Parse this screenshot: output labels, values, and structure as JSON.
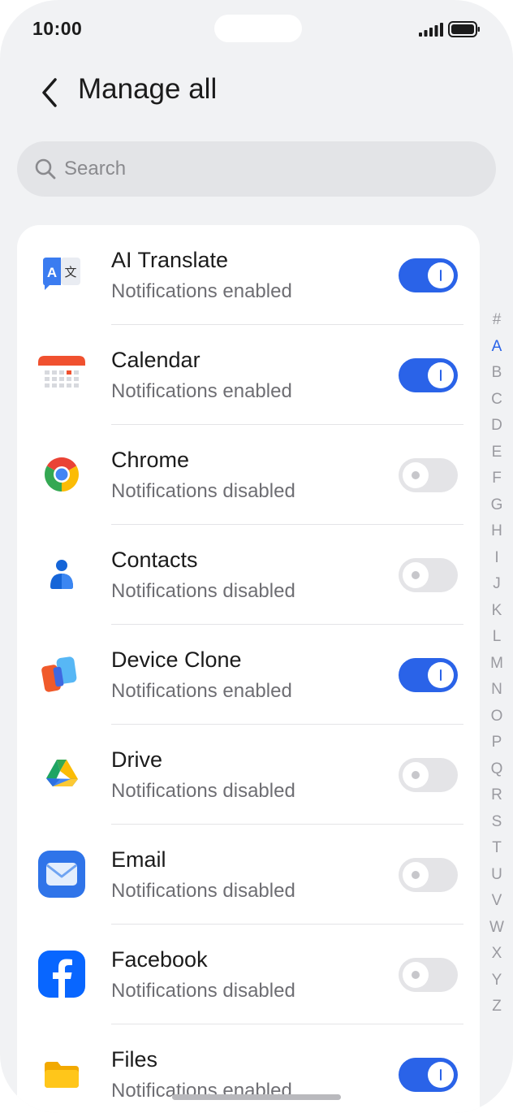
{
  "status_bar": {
    "time": "10:00"
  },
  "header": {
    "title": "Manage all"
  },
  "search": {
    "placeholder": "Search"
  },
  "apps": [
    {
      "name": "AI Translate",
      "status": "Notifications enabled",
      "enabled": true,
      "icon": "ai-translate-icon"
    },
    {
      "name": "Calendar",
      "status": "Notifications enabled",
      "enabled": true,
      "icon": "calendar-icon"
    },
    {
      "name": "Chrome",
      "status": "Notifications disabled",
      "enabled": false,
      "icon": "chrome-icon"
    },
    {
      "name": "Contacts",
      "status": "Notifications disabled",
      "enabled": false,
      "icon": "contacts-icon"
    },
    {
      "name": "Device Clone",
      "status": "Notifications enabled",
      "enabled": true,
      "icon": "device-clone-icon"
    },
    {
      "name": "Drive",
      "status": "Notifications disabled",
      "enabled": false,
      "icon": "drive-icon"
    },
    {
      "name": "Email",
      "status": "Notifications disabled",
      "enabled": false,
      "icon": "email-icon"
    },
    {
      "name": "Facebook",
      "status": "Notifications disabled",
      "enabled": false,
      "icon": "facebook-icon"
    },
    {
      "name": "Files",
      "status": "Notifications enabled",
      "enabled": true,
      "icon": "files-icon"
    }
  ],
  "index_letters": [
    "#",
    "A",
    "B",
    "C",
    "D",
    "E",
    "F",
    "G",
    "H",
    "I",
    "J",
    "K",
    "L",
    "M",
    "N",
    "O",
    "P",
    "Q",
    "R",
    "S",
    "T",
    "U",
    "V",
    "W",
    "X",
    "Y",
    "Z"
  ],
  "index_active": "A",
  "colors": {
    "accent": "#2a63e8",
    "background": "#f1f2f4",
    "card": "#ffffff"
  }
}
